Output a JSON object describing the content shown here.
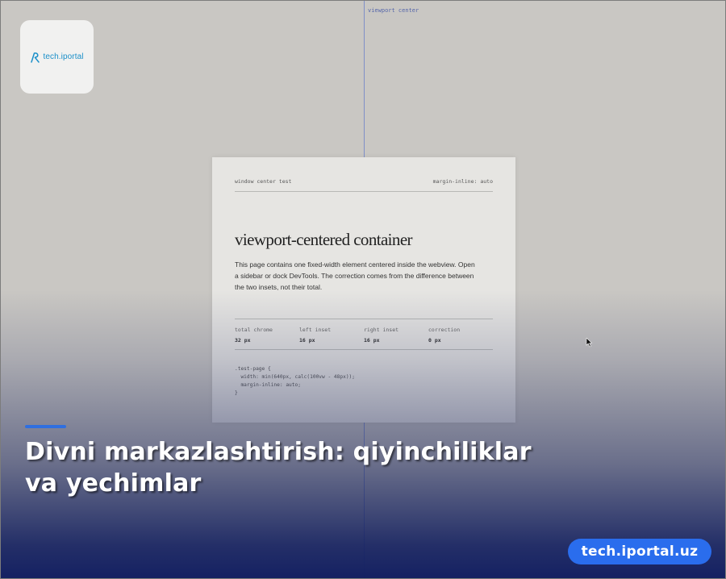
{
  "guide": {
    "label": "viewport center"
  },
  "logo": {
    "icon": "stylized-r-icon",
    "text": "tech.iportal",
    "color": "#1a8fc9"
  },
  "panel": {
    "header_left": "window center test",
    "header_right": "margin-inline: auto",
    "title": "viewport-centered container",
    "description": "This page contains one fixed-width element centered inside the webview. Open a sidebar or dock DevTools. The correction comes from the difference between the two insets, not their total.",
    "stats": [
      {
        "label": "total chrome",
        "value": "32 px"
      },
      {
        "label": "left inset",
        "value": "16 px"
      },
      {
        "label": "right inset",
        "value": "16 px"
      },
      {
        "label": "correction",
        "value": "0 px"
      }
    ],
    "code": ".test-page {\n  width: min(640px, calc(100vw - 48px));\n  margin-inline: auto;\n}"
  },
  "headline": "Divni markazlashtirish: qiyinchiliklar va yechimlar",
  "site_badge": "tech.iportal.uz",
  "colors": {
    "accent": "#2f6fe0",
    "badge": "#2a6ded",
    "overlay": "#14205f"
  }
}
